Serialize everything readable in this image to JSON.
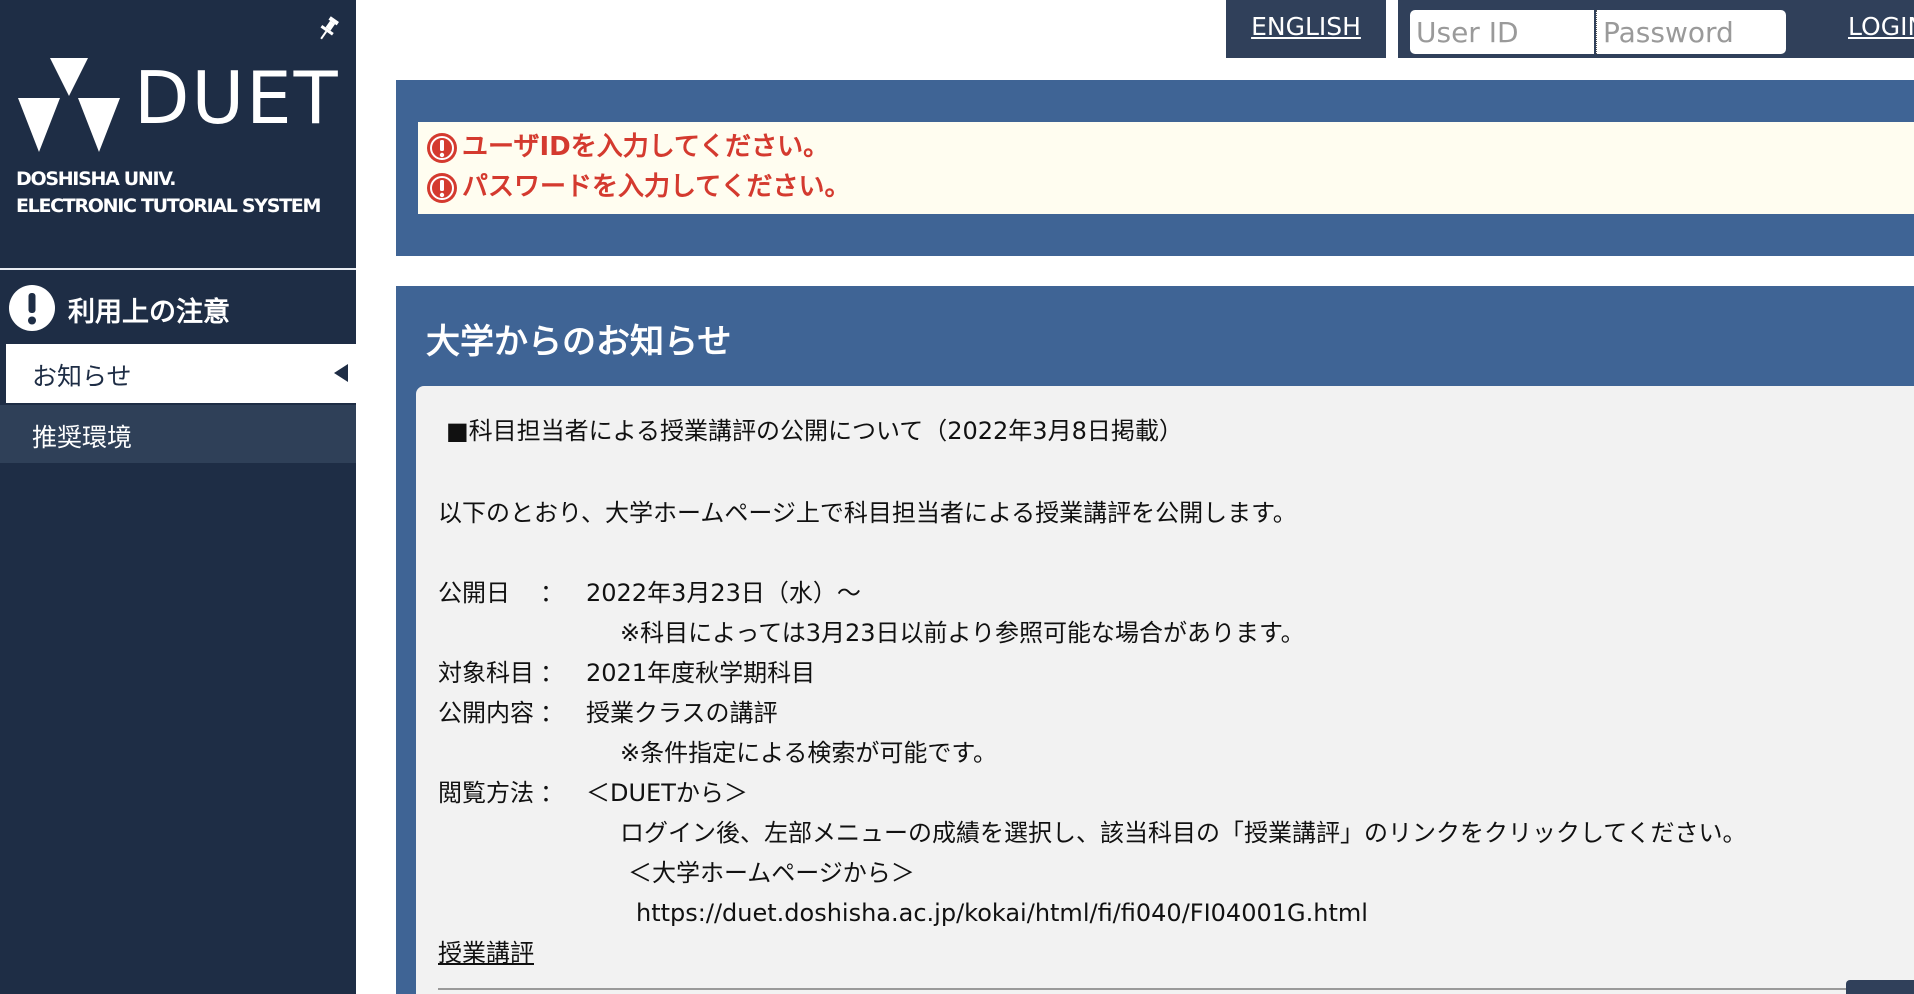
{
  "sidebar": {
    "logo_text": "DUET",
    "logo_sub_line1": "DOSHISHA UNIV.",
    "logo_sub_line2": "ELECTRONIC TUTORIAL SYSTEM",
    "notice_title": "利用上の注意",
    "items": [
      {
        "label": "お知らせ",
        "active": true
      },
      {
        "label": "推奨環境",
        "active": false
      }
    ]
  },
  "topbar": {
    "english_label": "ENGLISH",
    "userid_placeholder": "User ID",
    "password_placeholder": "Password",
    "login_label": "LOGIN"
  },
  "errors": [
    "ユーザIDを入力してください。",
    "パスワードを入力してください。"
  ],
  "info": {
    "title": "大学からのお知らせ",
    "heading": "■科目担当者による授業講評の公開について（2022年3月8日掲載）",
    "intro": "以下のとおり、大学ホームページ上で科目担当者による授業講評を公開します。",
    "publish_label": "公開日",
    "publish_value": "2022年3月23日（水）〜",
    "publish_note": "※科目によっては3月23日以前より参照可能な場合があります。",
    "subject_label": "対象科目",
    "subject_value": "2021年度秋学期科目",
    "content_label": "公開内容",
    "content_value": "授業クラスの講評",
    "content_note": "※条件指定による検索が可能です。",
    "method_label": "閲覧方法",
    "method_value": "＜DUETから＞",
    "method_note": "ログイン後、左部メニューの成績を選択し、該当科目の「授業講評」のリンクをクリックしてください。",
    "method_web": "＜大学ホームページから＞",
    "method_url": "https://duet.doshisha.ac.jp/kokai/html/fi/fi040/FI04001G.html",
    "colon": "：",
    "link_label": "授業講評"
  }
}
